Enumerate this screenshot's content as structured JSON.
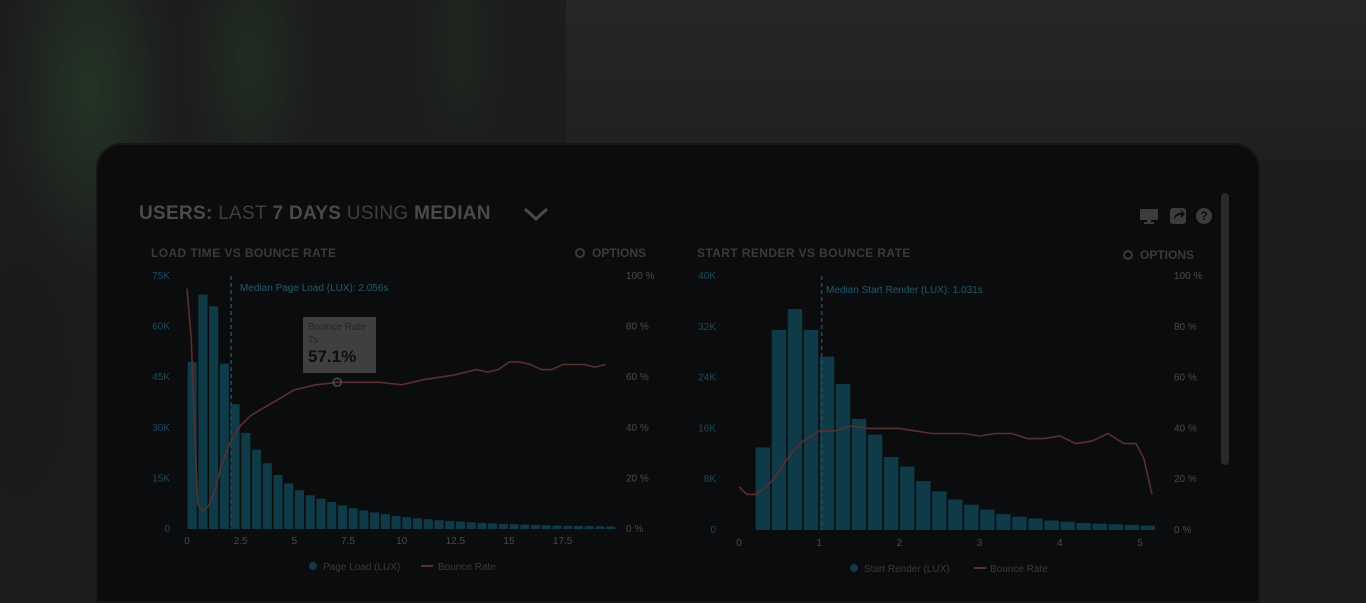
{
  "dashboard": {
    "title_prefix": "USERS:",
    "title_middle": "LAST",
    "title_days": "7 DAYS",
    "title_using": "USING",
    "title_metric": "MEDIAN",
    "icons": [
      "monitor-icon",
      "share-icon",
      "help-icon"
    ]
  },
  "colors": {
    "bar": "#0f3a48",
    "line": "#5a2f30",
    "median": "#1f4b5b"
  },
  "chart_data": [
    {
      "type": "bar",
      "title": "LOAD TIME VS BOUNCE RATE",
      "options_label": "OPTIONS",
      "yticks": [
        "0",
        "15K",
        "30K",
        "45K",
        "60K",
        "75K"
      ],
      "y2ticks": [
        "0 %",
        "20 %",
        "40 %",
        "60 %",
        "80 %",
        "100 %"
      ],
      "xticks": [
        "0",
        "2.5",
        "5",
        "7.5",
        "10",
        "12.5",
        "15",
        "17.5"
      ],
      "ylim": [
        0,
        75000
      ],
      "xlim": [
        0,
        19.8
      ],
      "bar_width": 0.5,
      "median_x": 2.056,
      "median_label": "Median Page Load (LUX): 2.056s",
      "legend": [
        "Page Load (LUX)",
        "Bounce Rate"
      ],
      "tooltip": {
        "title": "Bounce Rate",
        "sub": "7s",
        "value": "57.1%",
        "x": 7
      },
      "series": [
        {
          "name": "Page Load (LUX)",
          "x": [
            0,
            0.5,
            1,
            1.5,
            2,
            2.5,
            3,
            3.5,
            4,
            4.5,
            5,
            5.5,
            6,
            6.5,
            7,
            7.5,
            8,
            8.5,
            9,
            9.5,
            10,
            10.5,
            11,
            11.5,
            12,
            12.5,
            13,
            13.5,
            14,
            14.5,
            15,
            15.5,
            16,
            16.5,
            17,
            17.5,
            18,
            18.5,
            19,
            19.5
          ],
          "values": [
            49500,
            69500,
            66000,
            49000,
            37000,
            28500,
            23500,
            19500,
            16000,
            13500,
            11500,
            10000,
            9000,
            8000,
            7000,
            6200,
            5500,
            4900,
            4400,
            3900,
            3500,
            3200,
            2900,
            2600,
            2400,
            2200,
            2000,
            1800,
            1650,
            1500,
            1400,
            1300,
            1200,
            1100,
            1000,
            950,
            900,
            850,
            800,
            750
          ]
        },
        {
          "name": "Bounce Rate",
          "x": [
            0,
            0.2,
            0.35,
            0.5,
            0.7,
            1,
            1.3,
            1.6,
            2,
            2.5,
            3,
            4,
            5,
            6,
            7,
            8,
            9,
            10,
            11,
            11.8,
            12.5,
            13,
            13.5,
            14,
            14.5,
            15,
            15.5,
            16,
            16.5,
            17,
            17.5,
            18,
            18.5,
            19,
            19.5
          ],
          "values": [
            95,
            75,
            40,
            10,
            7,
            9,
            15,
            25,
            34,
            41,
            45,
            50,
            55,
            57,
            58,
            58,
            58,
            57,
            59,
            60,
            61,
            62,
            63,
            62,
            63,
            66,
            66,
            65,
            63,
            63,
            65,
            65,
            65,
            64,
            65
          ]
        }
      ]
    },
    {
      "type": "bar",
      "title": "START RENDER VS BOUNCE RATE",
      "options_label": "OPTIONS",
      "yticks": [
        "0",
        "8K",
        "16K",
        "24K",
        "32K",
        "40K"
      ],
      "y2ticks": [
        "0 %",
        "20 %",
        "40 %",
        "60 %",
        "80 %",
        "100 %"
      ],
      "xticks": [
        "0",
        "1",
        "2",
        "3",
        "4",
        "5"
      ],
      "ylim": [
        0,
        40000
      ],
      "xlim": [
        0,
        5.1
      ],
      "bar_width": 0.2,
      "median_x": 1.031,
      "median_label": "Median Start Render (LUX): 1.031s",
      "legend": [
        "Start Render (LUX)",
        "Bounce Rate"
      ],
      "series": [
        {
          "name": "Start Render (LUX)",
          "x": [
            0.2,
            0.4,
            0.6,
            0.8,
            1,
            1.2,
            1.4,
            1.6,
            1.8,
            2,
            2.2,
            2.4,
            2.6,
            2.8,
            3,
            3.2,
            3.4,
            3.6,
            3.8,
            4,
            4.2,
            4.4,
            4.6,
            4.8,
            5
          ],
          "values": [
            13000,
            31500,
            34800,
            31500,
            27300,
            23000,
            17500,
            15000,
            11500,
            10000,
            7700,
            6100,
            4800,
            4000,
            3200,
            2500,
            2100,
            1800,
            1500,
            1300,
            1100,
            1000,
            900,
            800,
            700
          ]
        },
        {
          "name": "Bounce Rate",
          "x": [
            0,
            0.1,
            0.2,
            0.3,
            0.4,
            0.5,
            0.6,
            0.7,
            0.8,
            0.9,
            1,
            1.2,
            1.4,
            1.6,
            1.8,
            2,
            2.2,
            2.4,
            2.6,
            2.8,
            3,
            3.2,
            3.4,
            3.6,
            3.8,
            4,
            4.2,
            4.4,
            4.6,
            4.8,
            4.95,
            5.05,
            5.15
          ],
          "values": [
            17,
            14,
            14,
            16,
            19,
            23,
            28,
            32,
            35,
            37,
            39,
            39,
            41,
            40,
            40,
            40,
            39,
            38,
            38,
            38,
            37,
            38,
            38,
            36,
            36,
            37,
            34,
            35,
            38,
            34,
            34,
            28,
            14
          ]
        }
      ]
    }
  ]
}
